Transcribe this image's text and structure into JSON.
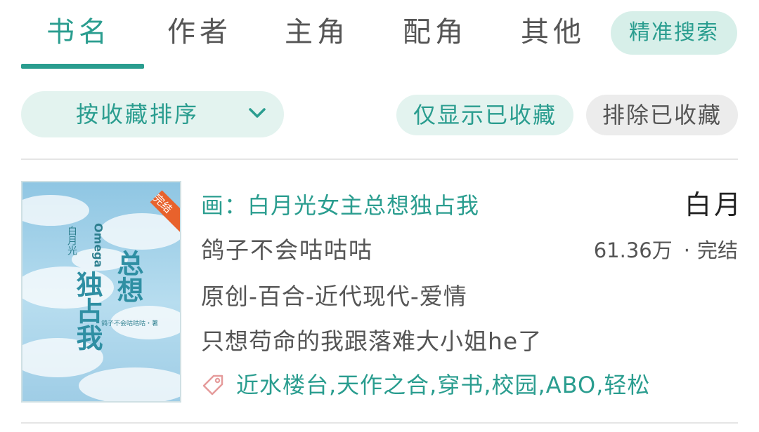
{
  "tabs": [
    {
      "label": "书名",
      "active": true
    },
    {
      "label": "作者",
      "active": false
    },
    {
      "label": "主角",
      "active": false
    },
    {
      "label": "配角",
      "active": false
    },
    {
      "label": "其他",
      "active": false
    }
  ],
  "precise_search_label": "精准搜索",
  "filters": {
    "sort_label": "按收藏排序",
    "fav_only_label": "仅显示已收藏",
    "exclude_fav_label": "排除已收藏"
  },
  "book": {
    "title": "白月",
    "subtitle": "画：白月光女主总想独占我",
    "author": "鸽子不会咕咕咕",
    "collections": "61.36万",
    "separator": "·",
    "status": "完结",
    "category": "原创-百合-近代现代-爱情",
    "intro": "只想苟命的我跟落难大小姐he了",
    "tags": "近水楼台,天作之合,穿书,校园,ABO,轻松",
    "cover": {
      "ribbon": "完结",
      "title_line1": "白月光",
      "title_line2": "Omega",
      "title_main1": "总想",
      "title_main2": "独占我",
      "author_line": "鸽子不会咕咕咕・著"
    }
  },
  "colors": {
    "accent": "#2a9d8f",
    "pill_bg": "#e3f3ef",
    "pill_grey": "#ececec",
    "ribbon": "#e8622c",
    "tag_icon": "#e59b9b"
  }
}
